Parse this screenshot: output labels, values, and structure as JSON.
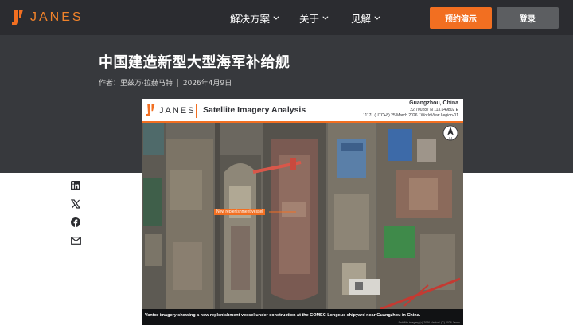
{
  "header": {
    "brand": "JANES",
    "nav": [
      {
        "label": "解决方案"
      },
      {
        "label": "关于"
      },
      {
        "label": "见解"
      }
    ],
    "demo_label": "预约演示",
    "login_label": "登录"
  },
  "article": {
    "title": "中国建造新型大型海军补给舰",
    "author": "作者：里兹万·拉赫马特",
    "date": "2026年4月9日"
  },
  "share_icons": [
    "linkedin-icon",
    "x-icon",
    "facebook-icon",
    "email-icon"
  ],
  "figure": {
    "brand": "JANES",
    "heading": "Satellite Imagery Analysis",
    "location": "Guangzhou, China",
    "coordinates": "22.700287 N 113.649802 E",
    "capture": "1117L (UTC+8) 25 March 2026 / WorldView Legion-01",
    "vessel_label": "New replenishment vessel",
    "caption": "Vantor imagery showing a new replenishment vessel under construction at the COMEC Longxue shipyard near Guangzhou in China.",
    "credit": "Satellite imagery (c) 2026 Vantor / (C) 2026 Janes"
  },
  "colors": {
    "accent": "#f26f21",
    "nav_bg": "#2b2c30",
    "band_bg": "#37393d",
    "login_bg": "#5c5e61"
  }
}
